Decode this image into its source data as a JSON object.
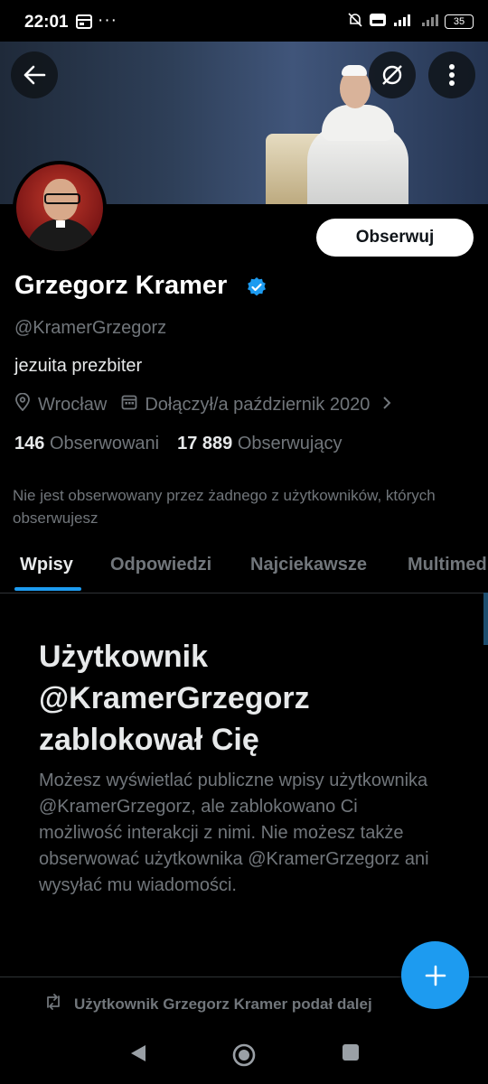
{
  "status_bar": {
    "time": "22:01",
    "dots": "···",
    "battery": "35"
  },
  "profile": {
    "name": "Grzegorz Kramer",
    "handle": "@KramerGrzegorz",
    "bio": "jezuita prezbiter",
    "location": "Wrocław",
    "joined": "Dołączył/a październik 2020",
    "following_count": "146",
    "following_label": "Obserwowani",
    "followers_count": "17 889",
    "followers_label": "Obserwujący",
    "followed_by_note": "Nie jest obserwowany przez żadnego z użytkowników, których obserwujesz",
    "verified_icon": "verified-badge-icon"
  },
  "actions": {
    "follow_label": "Obserwuj"
  },
  "tabs": [
    {
      "label": "Wpisy",
      "active": true
    },
    {
      "label": "Odpowiedzi",
      "active": false
    },
    {
      "label": "Najciekawsze",
      "active": false
    },
    {
      "label": "Multimedia",
      "active": false
    }
  ],
  "blocked": {
    "title": "Użytkownik @KramerGrzegorz zablokował Cię",
    "body": "Możesz wyświetlać publiczne wpisy użytkownika @KramerGrzegorz, ale zablokowano Ci możliwość interakcji z nimi. Nie możesz także obserwować użytkownika @KramerGrzegorz ani wysyłać mu wiadomości."
  },
  "feed": {
    "repost_note": "Użytkownik Grzegorz Kramer podał dalej"
  },
  "colors": {
    "accent": "#1d9bf0",
    "background": "#000000",
    "secondary_text": "#71767b"
  }
}
